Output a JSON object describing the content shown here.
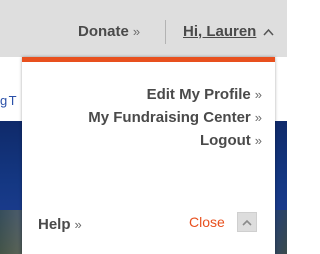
{
  "topbar": {
    "donate_label": "Donate",
    "donate_chevron": "»",
    "greeting_label": "Hi, Lauren",
    "greeting_caret": "^"
  },
  "background": {
    "link_fragment": "g T"
  },
  "dropdown": {
    "accent_color": "#e8501e",
    "menu_items": [
      {
        "label": "Edit My Profile",
        "chevron": "»"
      },
      {
        "label": "My Fundraising Center",
        "chevron": "»"
      },
      {
        "label": "Logout",
        "chevron": "»"
      }
    ],
    "help_label": "Help",
    "help_chevron": "»",
    "close_label": "Close",
    "close_icon": "chevron-up-icon"
  }
}
